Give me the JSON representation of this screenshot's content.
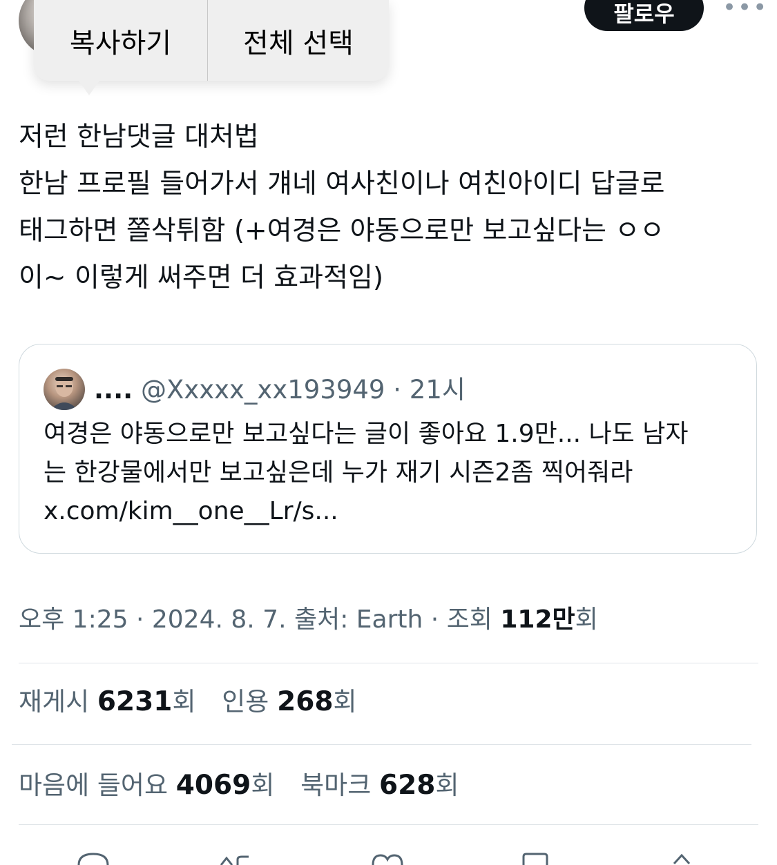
{
  "header": {
    "follow_label": "팔로우",
    "more_label": "•••"
  },
  "context_menu": {
    "copy_label": "복사하기",
    "select_all_label": "전체 선택"
  },
  "tweet": {
    "text": "저런 한남댓글 대처법\n한남 프로필 들어가서 걔네 여사친이나 여친아이디 답글로\n태그하면 쫄삭튀함 (+여경은 야동으로만 보고싶다는 ㅇㅇ\n이~ 이렇게 써주면 더 효과적임)"
  },
  "quote": {
    "name": "....",
    "handle": "@Xxxxx_xx193949",
    "separator": "·",
    "time": "21시",
    "text": "여경은 야동으로만 보고싶다는 글이 좋아요 1.9만... 나도 남자\n는 한강물에서만 보고싶은데 누가 재기 시즌2좀 찍어줘라\nx.com/kim__one__Lr/s..."
  },
  "meta": {
    "time": "오후 1:25",
    "sep1": " · ",
    "date": "2024. 8. 7.",
    "source_label": " 출처: ",
    "source": "Earth",
    "sep2": " · ",
    "views_label": "조회 ",
    "views_value": "112만",
    "views_suffix": "회"
  },
  "stats": {
    "retweets_label": "재게시 ",
    "retweets_value": "6231",
    "retweets_suffix": "회",
    "quotes_label": "인용 ",
    "quotes_value": "268",
    "quotes_suffix": "회",
    "likes_label": "마음에 들어요 ",
    "likes_value": "4069",
    "likes_suffix": "회",
    "bookmarks_label": "북마크 ",
    "bookmarks_value": "628",
    "bookmarks_suffix": "회"
  },
  "colors": {
    "text_primary": "#0f1419",
    "text_secondary": "#536471",
    "border": "#cfd9de",
    "menu_bg": "#efefef"
  },
  "icons": [
    "reply-icon",
    "retweet-icon",
    "like-icon",
    "bookmark-icon",
    "share-icon"
  ]
}
